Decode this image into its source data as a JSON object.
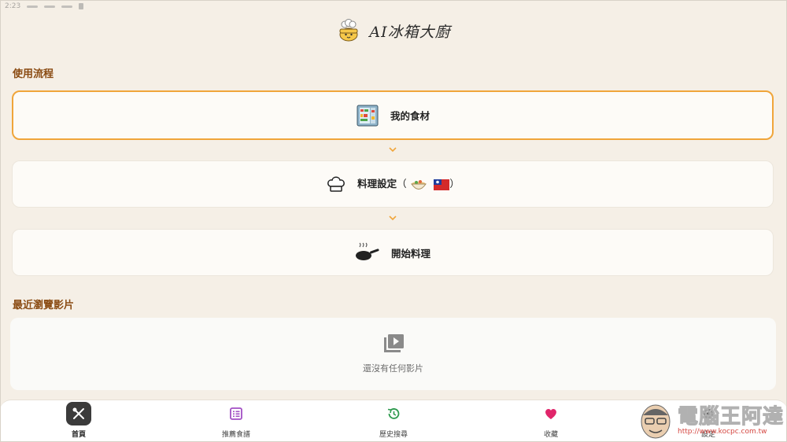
{
  "status_bar": {
    "time": "2:23"
  },
  "header": {
    "title": "AI冰箱大廚",
    "logo_icon": "chef-pot-icon"
  },
  "workflow": {
    "title": "使用流程",
    "steps": [
      {
        "label": "我的食材",
        "icon": "fridge-icon"
      },
      {
        "label": "料理設定",
        "paren_open": "（",
        "paren_close": "）",
        "icon": "chef-hat-icon",
        "extra_icons": [
          "food-bowl-icon",
          "taiwan-flag-icon"
        ]
      },
      {
        "label": "開始料理",
        "icon": "frying-pan-icon"
      }
    ]
  },
  "recent": {
    "title": "最近瀏覽影片",
    "empty_text": "還沒有任何影片",
    "icon": "video-library-icon"
  },
  "bottom_nav": {
    "items": [
      {
        "label": "首頁",
        "icon": "fork-knife-icon",
        "active": true
      },
      {
        "label": "推薦食譜",
        "icon": "recipe-list-icon",
        "color": "#a24fc4"
      },
      {
        "label": "歷史搜尋",
        "icon": "history-icon",
        "color": "#2e9a4e"
      },
      {
        "label": "收藏",
        "icon": "heart-icon",
        "color": "#e0256a"
      },
      {
        "label": "設定",
        "icon": "gear-icon"
      }
    ]
  },
  "watermark": {
    "title": "電腦王阿達",
    "url": "http://www.kocpc.com.tw"
  },
  "colors": {
    "accent": "#f0a53a",
    "section_title": "#8a4b12",
    "background": "#f5efe6"
  }
}
